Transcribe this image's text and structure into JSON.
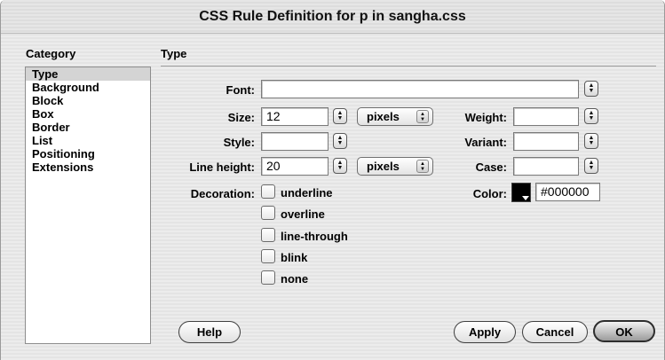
{
  "window": {
    "title": "CSS Rule Definition for p in sangha.css"
  },
  "category": {
    "heading": "Category",
    "items": [
      "Type",
      "Background",
      "Block",
      "Box",
      "Border",
      "List",
      "Positioning",
      "Extensions"
    ],
    "selected": "Type"
  },
  "panel": {
    "title": "Type"
  },
  "fields": {
    "font": {
      "label": "Font:",
      "value": ""
    },
    "size": {
      "label": "Size:",
      "value": "12",
      "unit": "pixels"
    },
    "style": {
      "label": "Style:",
      "value": ""
    },
    "line_height": {
      "label": "Line height:",
      "value": "20",
      "unit": "pixels"
    },
    "weight": {
      "label": "Weight:",
      "value": ""
    },
    "variant": {
      "label": "Variant:",
      "value": ""
    },
    "case": {
      "label": "Case:",
      "value": ""
    },
    "color": {
      "label": "Color:",
      "value": "#000000",
      "swatch": "#000000"
    }
  },
  "decoration": {
    "label": "Decoration:",
    "options": [
      "underline",
      "overline",
      "line-through",
      "blink",
      "none"
    ]
  },
  "buttons": {
    "help": "Help",
    "apply": "Apply",
    "cancel": "Cancel",
    "ok": "OK"
  },
  "icons": {
    "stepper": "up-down-arrows-icon",
    "swatch_menu": "triangle-down-icon"
  }
}
